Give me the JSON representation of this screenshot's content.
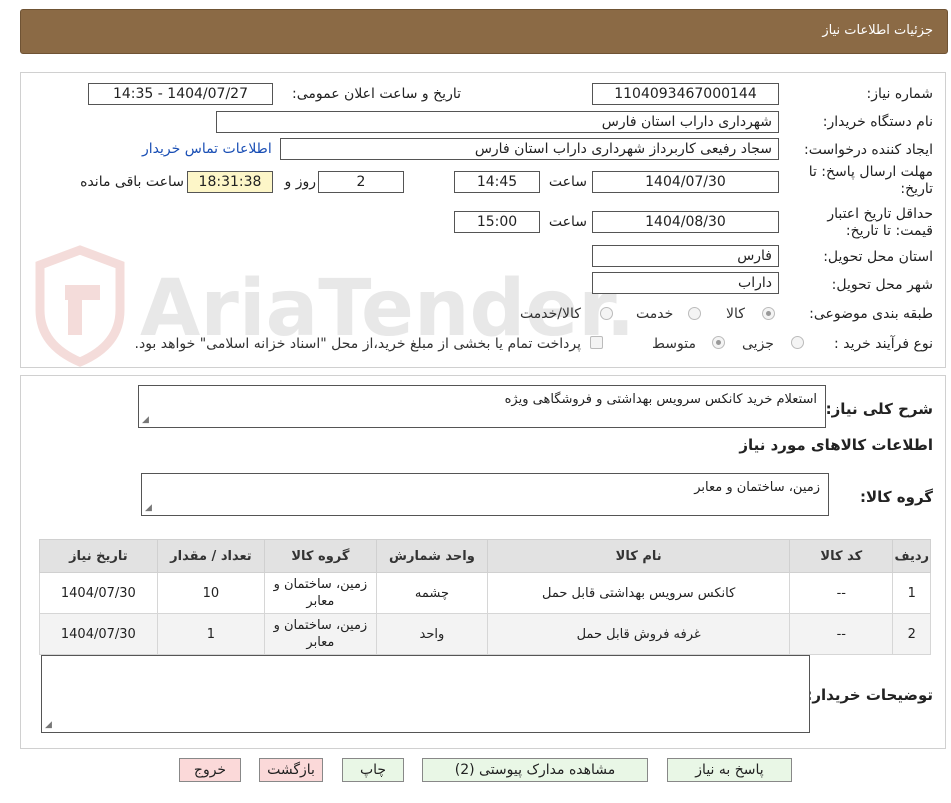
{
  "header": {
    "title": "جزئیات اطلاعات نیاز"
  },
  "form": {
    "need_number_label": "شماره نیاز:",
    "need_number": "1104093467000144",
    "announce_label": "تاریخ و ساعت اعلان عمومی:",
    "announce_value": "1404/07/27 - 14:35",
    "buyer_org_label": "نام دستگاه خریدار:",
    "buyer_org": "شهرداری داراب استان فارس",
    "requester_label": "ایجاد کننده درخواست:",
    "requester": "سجاد رفیعی کاربرداز  شهرداری داراب استان فارس",
    "contact_link": "اطلاعات تماس خریدار",
    "deadline_label": "مهلت ارسال پاسخ: تا تاریخ:",
    "deadline_date": "1404/07/30",
    "time_label": "ساعت",
    "deadline_time": "14:45",
    "days": "2",
    "days_label": "روز و",
    "remaining": "18:31:38",
    "remaining_label": "ساعت باقی مانده",
    "validity_label": "حداقل تاریخ اعتبار قیمت: تا تاریخ:",
    "validity_date": "1404/08/30",
    "validity_time": "15:00",
    "province_label": "استان محل تحویل:",
    "province": "فارس",
    "city_label": "شهر محل تحویل:",
    "city": "داراب",
    "category_label": "طبقه بندی موضوعی:",
    "category_options": [
      "کالا",
      "خدمت",
      "کالا/خدمت"
    ],
    "process_label": "نوع فرآیند خرید :",
    "process_options": [
      "جزیی",
      "متوسط"
    ],
    "payment_note": "پرداخت تمام یا بخشی از مبلغ خرید،از محل \"اسناد خزانه اسلامی\" خواهد بود."
  },
  "summary": {
    "label": "شرح کلی نیاز:",
    "text": "استعلام خرید کانکس سرویس بهداشتی و فروشگاهی ویژه"
  },
  "goods": {
    "section_title": "اطلاعات کالاهای مورد نیاز",
    "group_label": "گروه کالا:",
    "group_value": "زمین، ساختمان و معابر",
    "columns": [
      "ردیف",
      "کد کالا",
      "نام کالا",
      "واحد شمارش",
      "گروه کالا",
      "تعداد / مقدار",
      "تاریخ نیاز"
    ],
    "rows": [
      [
        "1",
        "--",
        "کانکس سرویس بهداشتی قابل حمل",
        "چشمه",
        "زمین، ساختمان و معابر",
        "10",
        "1404/07/30"
      ],
      [
        "2",
        "--",
        "غرفه فروش قابل حمل",
        "واحد",
        "زمین، ساختمان و معابر",
        "1",
        "1404/07/30"
      ]
    ]
  },
  "buyer_notes": {
    "label": "توضیحات خریدار:",
    "text": ""
  },
  "buttons": {
    "reply": "پاسخ به نیاز",
    "attachments": "مشاهده مدارک پیوستی (2)",
    "print": "چاپ",
    "back": "بازگشت",
    "exit": "خروج"
  },
  "watermark": {
    "text": "AriaTender.neT"
  },
  "colors": {
    "header": "#8b6a45",
    "link": "#1a4fb5",
    "accent_yellow": "#fdf6c8",
    "button_green": "#e9f7e6",
    "button_red": "#fbd9d9"
  }
}
